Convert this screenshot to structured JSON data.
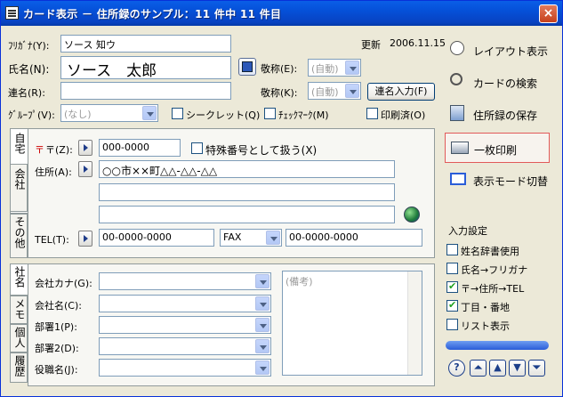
{
  "window": {
    "title": "カード表示 － 住所録のサンプル：11 件中 11 件目",
    "close_glyph": "×"
  },
  "header": {
    "furigana_label": "ﾌﾘｶﾞﾅ(Y):",
    "furigana_value": "ソース 知ウ",
    "updated_label": "更新",
    "updated_date": "2006.11.15",
    "name_label": "氏名(N):",
    "name_value": "ソース　太郎",
    "honorific_label_1": "敬称(E):",
    "honorific_value_1": "(自動)",
    "joint_name_label": "連名(R):",
    "joint_name_value": "",
    "honorific_label_2": "敬称(K):",
    "honorific_value_2": "(自動)",
    "joint_name_input_button": "連名入力(F)",
    "group_label": "ｸﾞﾙｰﾌﾟ(V):",
    "group_value": "(なし)",
    "secret_label": "シークレット(Q)",
    "checkmark_label": "ﾁｪｯｸﾏｰｸ(M)",
    "printed_label": "印刷済(O)"
  },
  "upper_tabs": [
    {
      "label": "自宅"
    },
    {
      "label": "会社"
    },
    {
      "label": "その他"
    }
  ],
  "address": {
    "postal_label": "〒(Z):",
    "postal_value": "000-0000",
    "special_number_label": "特殊番号として扱う(X)",
    "address_label": "住所(A):",
    "address_line1": "○○市××町△△-△△-△△",
    "address_line2": "",
    "address_line3": "",
    "tel_label": "TEL(T):",
    "tel_value": "00-0000-0000",
    "fax_select": "FAX",
    "fax_value": "00-0000-0000"
  },
  "lower_tabs": [
    {
      "label": "社名"
    },
    {
      "label": "メモ"
    },
    {
      "label": "個人"
    },
    {
      "label": "履歴"
    }
  ],
  "company": {
    "company_kana_label": "会社カナ(G):",
    "company_name_label": "会社名(C):",
    "dept1_label": "部署1(P):",
    "dept2_label": "部署2(D):",
    "title_label": "役職名(J):",
    "memo_placeholder": "(備考)"
  },
  "sidebar": {
    "buttons": [
      {
        "label": "レイアウト表示"
      },
      {
        "label": "カードの検索"
      },
      {
        "label": "住所録の保存"
      },
      {
        "label": "一枚印刷"
      },
      {
        "label": "表示モード切替"
      }
    ],
    "input_settings_title": "入力設定",
    "options": [
      {
        "label": "姓名辞書使用",
        "checked": false
      },
      {
        "label": "氏名→フリガナ",
        "checked": false
      },
      {
        "label": "〒→住所→TEL",
        "checked": true
      },
      {
        "label": "丁目・番地",
        "checked": true
      },
      {
        "label": "リスト表示",
        "checked": false
      }
    ],
    "nav": {
      "help": "?",
      "first": "⏶",
      "prev": "▲",
      "next": "▼",
      "last": "⏷"
    }
  },
  "colors": {
    "title_blue": "#0550d8",
    "accent_red": "#e25a5a",
    "check_green": "#21a121"
  }
}
